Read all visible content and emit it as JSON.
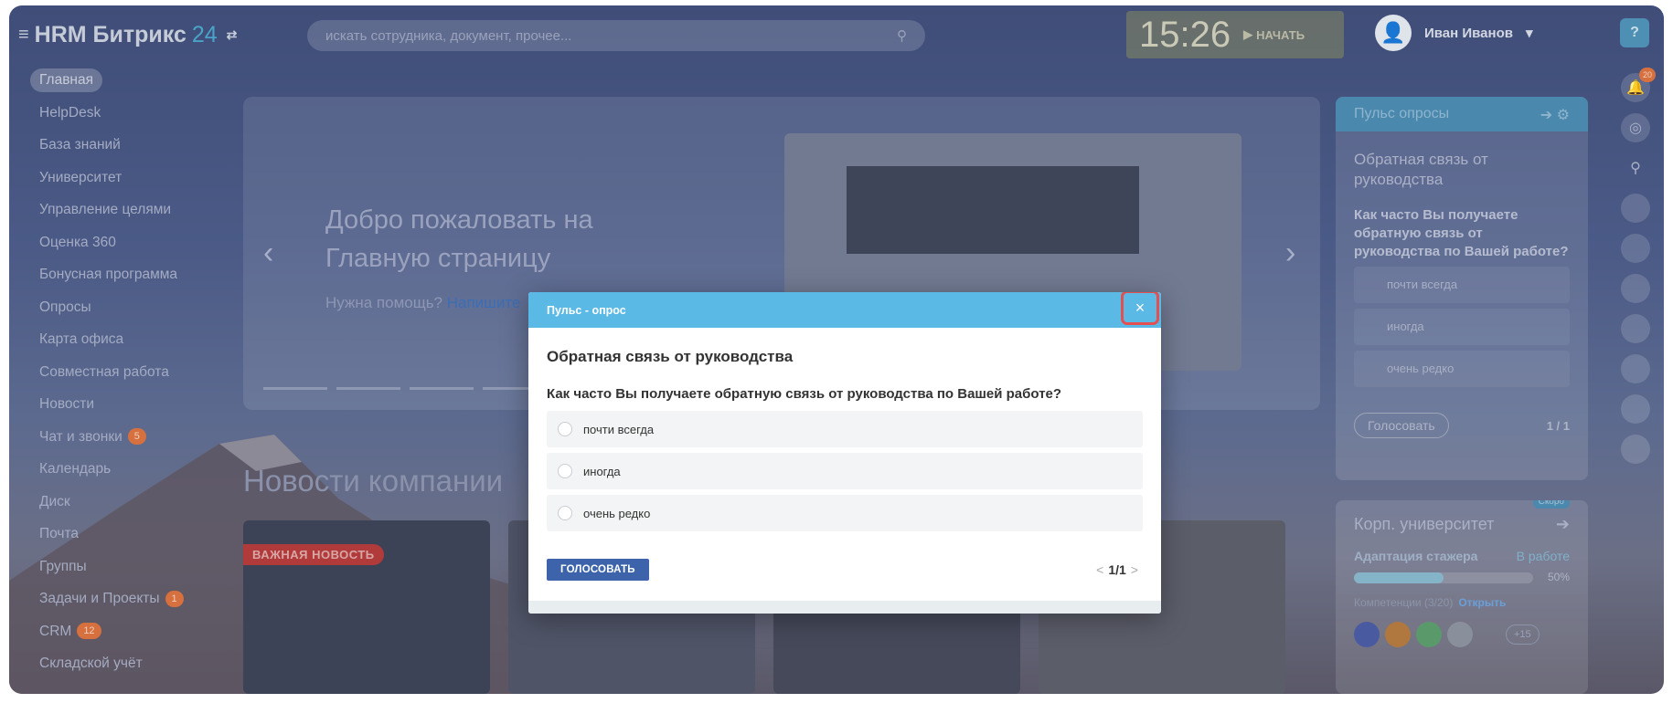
{
  "header": {
    "logo_text": "HRM Битрикс",
    "logo_num": "24",
    "search_placeholder": "искать сотрудника, документ, прочее...",
    "clock": "15:26",
    "start_label": "НАЧАТЬ",
    "user_name": "Иван Иванов",
    "help": "?"
  },
  "sidebar": {
    "items": [
      {
        "label": "Главная",
        "active": true
      },
      {
        "label": "HelpDesk"
      },
      {
        "label": "База знаний"
      },
      {
        "label": "Университет"
      },
      {
        "label": "Управление целями"
      },
      {
        "label": "Оценка 360"
      },
      {
        "label": "Бонусная программа"
      },
      {
        "label": "Опросы"
      },
      {
        "label": "Карта офиса"
      },
      {
        "label": "Совместная работа"
      },
      {
        "label": "Новости"
      },
      {
        "label": "Чат и звонки",
        "count": "5"
      },
      {
        "label": "Календарь"
      },
      {
        "label": "Диск"
      },
      {
        "label": "Почта"
      },
      {
        "label": "Группы"
      },
      {
        "label": "Задачи и Проекты",
        "count": "1"
      },
      {
        "label": "CRM",
        "count": "12"
      },
      {
        "label": "Складской учёт"
      }
    ]
  },
  "banner": {
    "title": "Добро пожаловать на Главную страницу",
    "help_prefix": "Нужна помощь?",
    "help_link": "Напишите"
  },
  "news": {
    "title": "Новости компании",
    "badge": "ВАЖНАЯ НОВОСТЬ"
  },
  "pulse_widget": {
    "title": "Пульс опросы",
    "survey": "Обратная связь от руководства",
    "question": "Как часто Вы получаете обратную связь от руководства по Вашей работе?",
    "options": [
      "почти всегда",
      "иногда",
      "очень редко"
    ],
    "vote": "Голосовать",
    "pager": "1 / 1"
  },
  "university_widget": {
    "title": "Корп. университет",
    "new_tag": "Скоро",
    "course": "Адаптация стажера",
    "status": "В работе",
    "progress": "50%",
    "progress_value": 50,
    "competence": "Компетенции (3/20)",
    "open": "Открыть",
    "more": "+15"
  },
  "rail": {
    "notifications_count": "20"
  },
  "modal": {
    "header": "Пульс - опрос",
    "close": "×",
    "title": "Обратная связь от руководства",
    "question": "Как часто Вы получаете обратную связь от руководства по Вашей работе?",
    "options": [
      "почти всегда",
      "иногда",
      "очень редко"
    ],
    "vote": "ГОЛОСОВАТЬ",
    "page": "1/1",
    "prev": "<",
    "next": ">"
  }
}
